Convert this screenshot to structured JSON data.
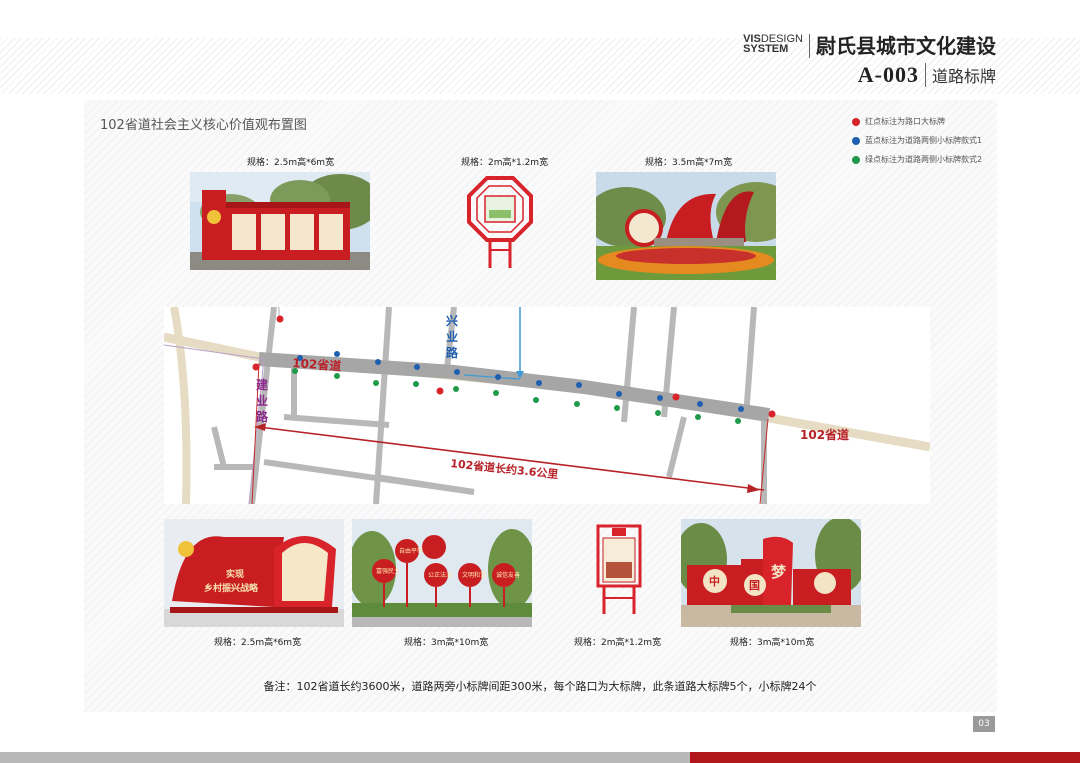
{
  "header": {
    "vis_line1a": "VIS",
    "vis_line1b": "DESIGN",
    "vis_line2": "SYSTEM",
    "title": "尉氏县城市文化建设",
    "code": "A-003",
    "subtitle": "道路标牌"
  },
  "panel_title": "102省道社会主义核心价值观布置图",
  "legend": [
    {
      "text": "红点标注为路口大标牌",
      "color": "#d8232a"
    },
    {
      "text": "蓝点标注为道路两侧小标牌款式1",
      "color": "#1f5fb0"
    },
    {
      "text": "绿点标注为道路两侧小标牌款式2",
      "color": "#1f9a4a"
    }
  ],
  "top_signs": [
    {
      "spec": "规格：2.5m高*6m宽"
    },
    {
      "spec": "规格：2m高*1.2m宽"
    },
    {
      "spec": "规格：3.5m高*7m宽"
    }
  ],
  "bottom_signs": [
    {
      "spec": "规格：2.5m高*6m宽"
    },
    {
      "spec": "规格：3m高*10m宽"
    },
    {
      "spec": "规格：2m高*1.2m宽"
    },
    {
      "spec": "规格：3m高*10m宽"
    }
  ],
  "map": {
    "road_main": "102省道",
    "road_main_right": "102省道",
    "road_xingye": "兴业路",
    "road_jianye": "建业路",
    "length_label": "102省道长约3.6公里"
  },
  "sign_text": {
    "a_slogan1": "实现",
    "a_slogan2": "乡村振兴战略",
    "b_circles": [
      "自由平等",
      "富强民主",
      "公正法治",
      "文明和谐",
      "诚信友善"
    ],
    "d_chars": [
      "中",
      "国",
      "梦"
    ]
  },
  "note": "备注：102省道长约3600米，道路两旁小标牌间距300米，每个路口为大标牌，此条道路大标牌5个，小标牌24个",
  "page_number": "03",
  "colors": {
    "accent_red": "#d8232a",
    "blue": "#1f5fb0",
    "green": "#1f9a4a",
    "footer_red": "#b1161b"
  }
}
